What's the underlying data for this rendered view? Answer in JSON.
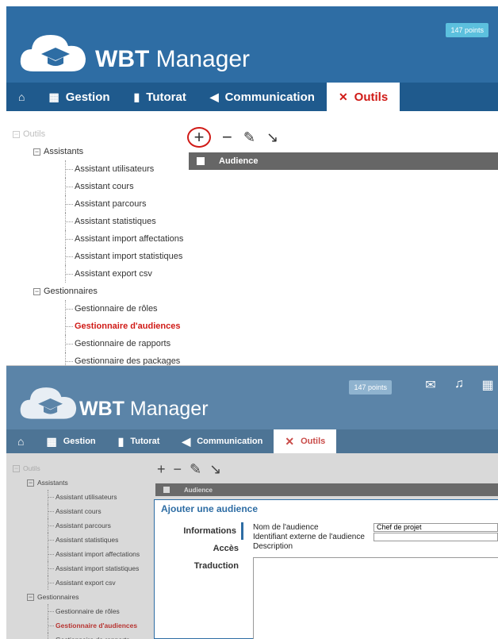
{
  "top": {
    "app_name_bold": "WBT",
    "app_name_rest": " Manager",
    "points": "147 points",
    "nav": [
      {
        "label": ""
      },
      {
        "label": "Gestion"
      },
      {
        "label": "Tutorat"
      },
      {
        "label": "Communication"
      },
      {
        "label": "Outils"
      }
    ],
    "tree": {
      "root": "Outils",
      "group1": "Assistants",
      "assistants": [
        "Assistant utilisateurs",
        "Assistant cours",
        "Assistant parcours",
        "Assistant statistiques",
        "Assistant import affectations",
        "Assistant import statistiques",
        "Assistant export csv"
      ],
      "group2": "Gestionnaires",
      "gestionnaires": [
        "Gestionnaire de rôles",
        "Gestionnaire d'audiences",
        "Gestionnaire de rapports",
        "Gestionnaire des packages"
      ]
    },
    "grid_header": "Audience"
  },
  "bottom": {
    "app_name_bold": "WBT",
    "app_name_rest": " Manager",
    "points": "147 points",
    "nav": [
      {
        "label": "Gestion"
      },
      {
        "label": "Tutorat"
      },
      {
        "label": "Communication"
      },
      {
        "label": "Outils"
      }
    ],
    "tree": {
      "root": "Outils",
      "group1": "Assistants",
      "assistants": [
        "Assistant utilisateurs",
        "Assistant cours",
        "Assistant parcours",
        "Assistant statistiques",
        "Assistant import affectations",
        "Assistant import statistiques",
        "Assistant export csv"
      ],
      "group2": "Gestionnaires",
      "gestionnaires": [
        "Gestionnaire de rôles",
        "Gestionnaire d'audiences",
        "Gestionnaire de rapports"
      ]
    },
    "grid_header": "Audience",
    "dialog": {
      "title": "Ajouter une audience",
      "tabs": [
        "Informations",
        "Accès",
        "Traduction"
      ],
      "fields": {
        "name_label": "Nom de l'audience",
        "name_value": "Chef de projet",
        "external_id_label": "Identifiant externe de l'audience",
        "external_id_value": "",
        "description_label": "Description"
      }
    }
  },
  "colors": {
    "header_blue": "#2e6da4",
    "nav_blue": "#1f5a8d",
    "active_red": "#d01b17",
    "badge": "#5cc0de"
  }
}
